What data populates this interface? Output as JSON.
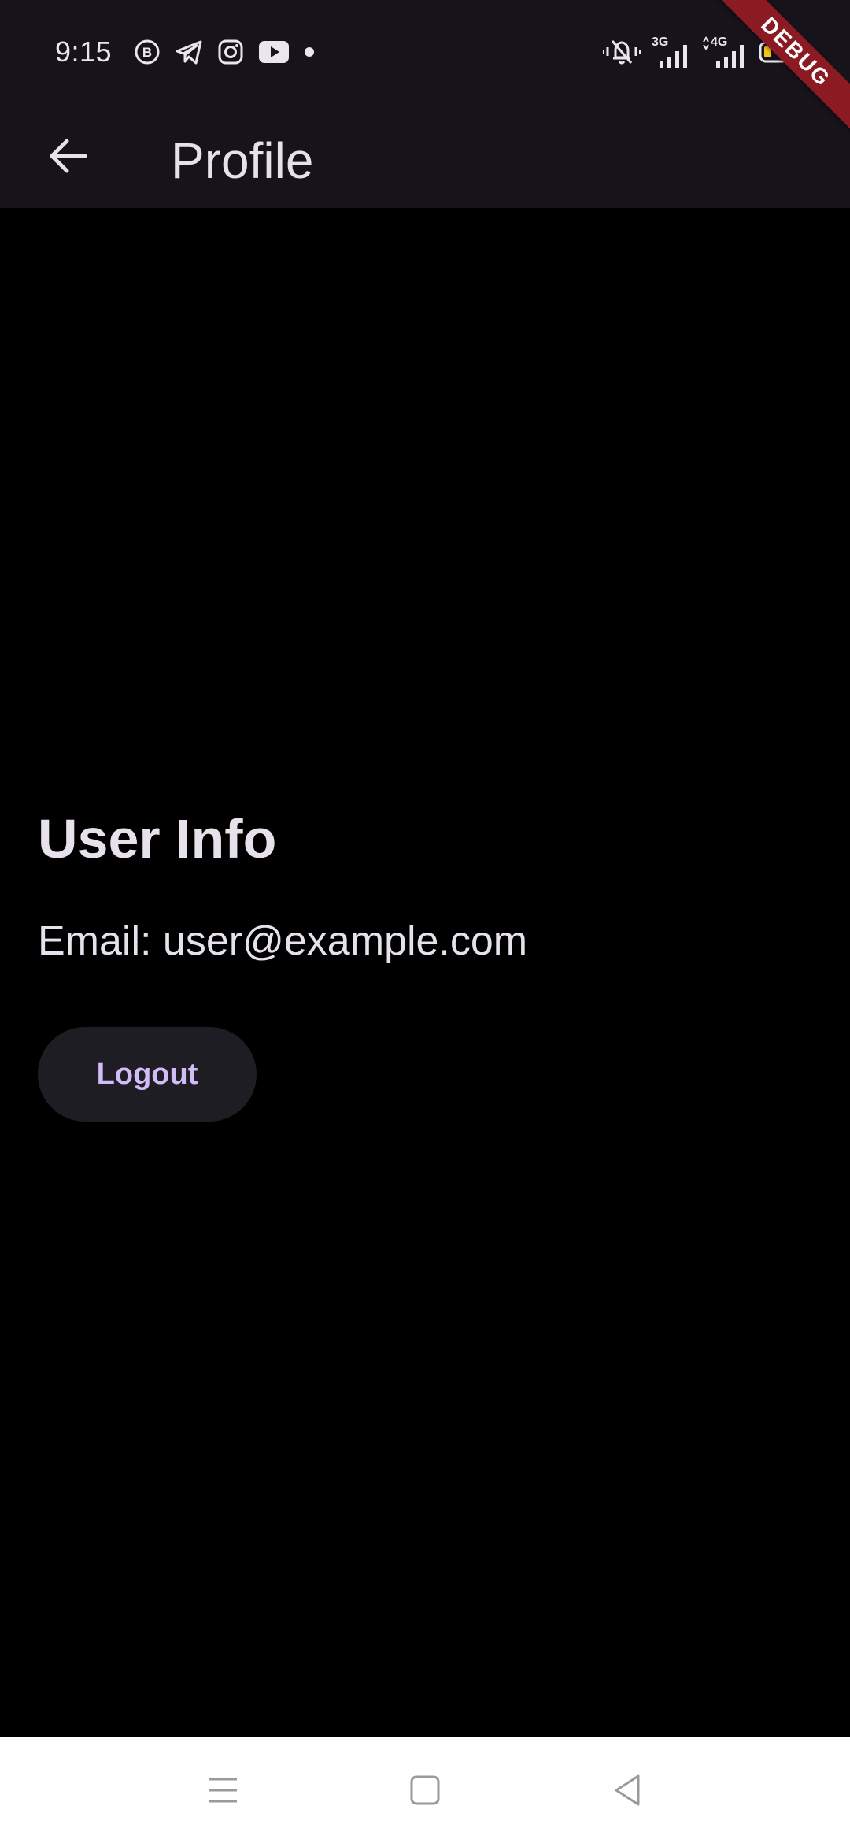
{
  "status_bar": {
    "time": "9:15",
    "notification_icons": [
      "business-chat-icon",
      "telegram-icon",
      "instagram-icon",
      "youtube-icon",
      "more-dot-icon"
    ],
    "system_icons": [
      "vibrate-mute-icon",
      "signal-3g-icon",
      "signal-4g-icon",
      "battery-icon"
    ],
    "network_labels": [
      "3G",
      "4G"
    ],
    "battery_color": "#f5c518"
  },
  "app_bar": {
    "title": "Profile",
    "back_icon": "arrow-back-icon"
  },
  "debug_banner": {
    "label": "DEBUG"
  },
  "profile": {
    "section_title": "User Info",
    "email_line": "Email: user@example.com",
    "logout_label": "Logout"
  },
  "navigation_bar": {
    "buttons": [
      "menu-icon",
      "home-square-icon",
      "back-triangle-icon"
    ]
  },
  "colors": {
    "app_bar_bg": "#16141a",
    "content_bg": "#000000",
    "text_primary": "#e6e1ea",
    "button_bg": "#1f1d24",
    "button_text": "#d2bcf8",
    "debug_banner": "#8c1a22",
    "nav_bar_bg": "#ffffff"
  }
}
